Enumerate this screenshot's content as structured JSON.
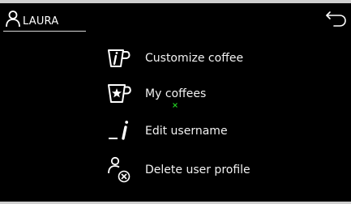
{
  "header": {
    "user_name": "LAURA",
    "user_icon": "user-icon",
    "back_icon": "back-arrow-icon"
  },
  "menu": {
    "items": [
      {
        "label": "Customize coffee",
        "icon": "cup-i-icon"
      },
      {
        "label": "My coffees",
        "icon": "cup-star-icon"
      },
      {
        "label": "Edit username",
        "icon": "edit-i-icon"
      },
      {
        "label": "Delete user profile",
        "icon": "delete-user-icon"
      }
    ]
  },
  "colors": {
    "background": "#000000",
    "text": "#ffffff",
    "cursor_marker": "#22cc22"
  }
}
